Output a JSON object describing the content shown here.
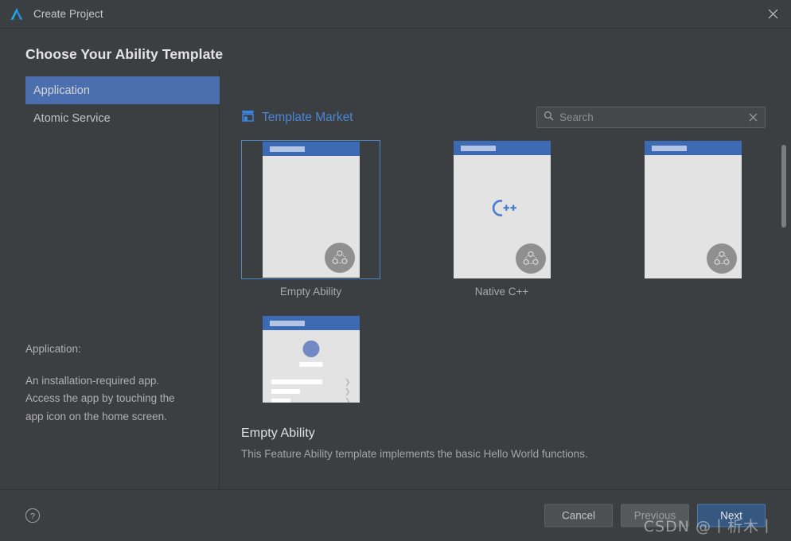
{
  "window": {
    "title": "Create Project",
    "logo_icon": "deveco-logo-icon",
    "close_icon": "close-icon"
  },
  "page": {
    "heading": "Choose Your Ability Template"
  },
  "sidebar": {
    "items": [
      {
        "label": "Application",
        "selected": true
      },
      {
        "label": "Atomic Service",
        "selected": false
      }
    ],
    "description": {
      "lead": "Application:",
      "body": "An installation-required app.\nAccess the app by touching the\napp icon on the home screen."
    }
  },
  "market": {
    "label": "Template Market",
    "icon": "store-icon"
  },
  "search": {
    "placeholder": "Search",
    "value": "",
    "search_icon": "search-icon",
    "clear_icon": "close-icon"
  },
  "templates": [
    {
      "name": "Empty Ability",
      "preview": "blank",
      "selected": true
    },
    {
      "name": "Native C++",
      "preview": "cpp",
      "selected": false
    },
    {
      "name": "",
      "preview": "blank",
      "selected": false
    },
    {
      "name": "",
      "preview": "settings",
      "selected": false
    }
  ],
  "detail": {
    "title": "Empty Ability",
    "description": "This Feature Ability template implements the basic Hello World functions."
  },
  "footer": {
    "help_icon": "help-icon",
    "cancel_label": "Cancel",
    "previous_label": "Previous",
    "next_label": "Next"
  },
  "watermark": {
    "text": "CSDN @丨析木丨"
  },
  "colors": {
    "accent_blue": "#4b6eaf",
    "link_blue": "#4a86d8",
    "primary_button": "#365880",
    "selection_border": "#4a88c7",
    "window_bg": "#3c3f41",
    "phone_header": "#3c6bb4"
  }
}
